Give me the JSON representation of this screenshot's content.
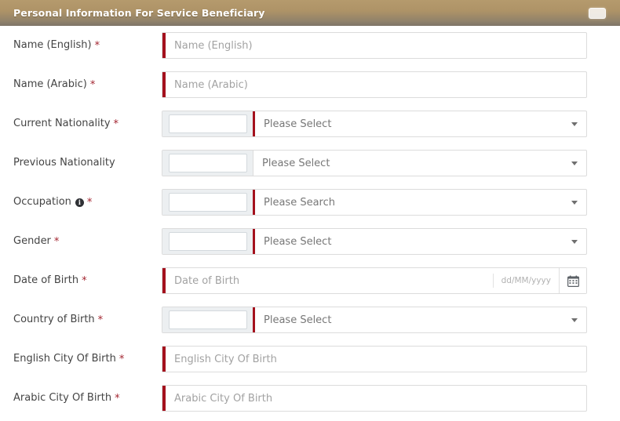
{
  "header": {
    "title": "Personal Information For Service Beneficiary",
    "collapse_label": "",
    "collapse_icon": "minimize-dash-icon",
    "accent_color": "#ae9367"
  },
  "theme": {
    "required_marker_color": "#a4111d",
    "asterisk_color": "#a32530",
    "label_color": "#444444",
    "placeholder_color": "#a2a2a2"
  },
  "form": {
    "required_mark": "*",
    "rows": [
      {
        "type": "text",
        "name": "name-english",
        "label": "Name (English)",
        "required": true,
        "info": false,
        "placeholder": "Name (English)",
        "value": ""
      },
      {
        "type": "text",
        "name": "name-arabic",
        "label": "Name (Arabic)",
        "required": true,
        "info": false,
        "placeholder": "Name (Arabic)",
        "value": ""
      },
      {
        "type": "combo",
        "name": "current-nationality",
        "label": "Current Nationality",
        "required": true,
        "info": false,
        "code_value": "",
        "code_placeholder": "",
        "select_text": "Please Select",
        "caret_icon": "chevron-down-icon"
      },
      {
        "type": "combo",
        "name": "previous-nationality",
        "label": "Previous Nationality",
        "required": false,
        "info": false,
        "code_value": "",
        "code_placeholder": "",
        "select_text": "Please Select",
        "caret_icon": "chevron-down-icon"
      },
      {
        "type": "combo",
        "name": "occupation",
        "label": "Occupation",
        "required": true,
        "info": true,
        "info_icon": "info-circle-icon",
        "info_glyph": "i",
        "code_value": "",
        "code_placeholder": "",
        "select_text": "Please Search",
        "caret_icon": "chevron-down-icon"
      },
      {
        "type": "combo",
        "name": "gender",
        "label": "Gender",
        "required": true,
        "info": false,
        "code_value": "",
        "code_placeholder": "",
        "select_text": "Please Select",
        "caret_icon": "chevron-down-icon"
      },
      {
        "type": "date",
        "name": "date-of-birth",
        "label": "Date of Birth",
        "required": true,
        "info": false,
        "placeholder": "Date of Birth",
        "value": "",
        "format_hint": "dd/MM/yyyy",
        "calendar_icon": "calendar-icon"
      },
      {
        "type": "combo",
        "name": "country-of-birth",
        "label": "Country of Birth",
        "required": true,
        "info": false,
        "code_value": "",
        "code_placeholder": "",
        "select_text": "Please Select",
        "caret_icon": "chevron-down-icon"
      },
      {
        "type": "text",
        "name": "english-city-of-birth",
        "label": "English City Of Birth",
        "required": true,
        "info": false,
        "placeholder": "English City Of Birth",
        "value": ""
      },
      {
        "type": "text",
        "name": "arabic-city-of-birth",
        "label": "Arabic City Of Birth",
        "required": true,
        "info": false,
        "placeholder": "Arabic City Of Birth",
        "value": ""
      }
    ]
  }
}
